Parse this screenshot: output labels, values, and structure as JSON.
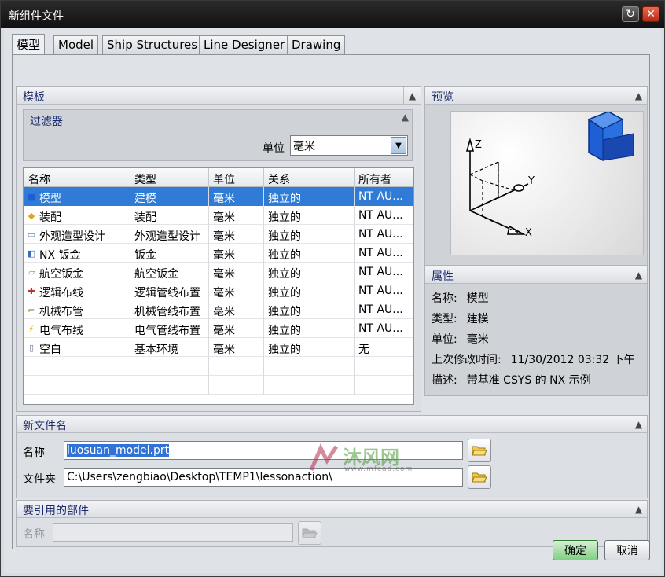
{
  "window": {
    "title": "新组件文件"
  },
  "tabs": [
    {
      "label": "模型",
      "active": true
    },
    {
      "label": "Model"
    },
    {
      "label": "Ship Structures"
    },
    {
      "label": "Line Designer"
    },
    {
      "label": "Drawing"
    }
  ],
  "template": {
    "header": "模板",
    "filter": {
      "title": "过滤器",
      "unit_label": "单位",
      "unit_value": "毫米"
    },
    "columns": [
      "名称",
      "类型",
      "单位",
      "关系",
      "所有者"
    ],
    "rows": [
      {
        "name": "模型",
        "type": "建模",
        "unit": "毫米",
        "relation": "独立的",
        "owner": "NT AU...",
        "icon": "model-icon",
        "selected": true
      },
      {
        "name": "装配",
        "type": "装配",
        "unit": "毫米",
        "relation": "独立的",
        "owner": "NT AU...",
        "icon": "assembly-icon"
      },
      {
        "name": "外观造型设计",
        "type": "外观造型设计",
        "unit": "毫米",
        "relation": "独立的",
        "owner": "NT AU...",
        "icon": "shape-studio-icon"
      },
      {
        "name": "NX 钣金",
        "type": "钣金",
        "unit": "毫米",
        "relation": "独立的",
        "owner": "NT AU...",
        "icon": "sheet-metal-icon"
      },
      {
        "name": "航空钣金",
        "type": "航空钣金",
        "unit": "毫米",
        "relation": "独立的",
        "owner": "NT AU...",
        "icon": "aero-sheet-metal-icon"
      },
      {
        "name": "逻辑布线",
        "type": "逻辑管线布置",
        "unit": "毫米",
        "relation": "独立的",
        "owner": "NT AU...",
        "icon": "logical-routing-icon"
      },
      {
        "name": "机械布管",
        "type": "机械管线布置",
        "unit": "毫米",
        "relation": "独立的",
        "owner": "NT AU...",
        "icon": "mechanical-routing-icon"
      },
      {
        "name": "电气布线",
        "type": "电气管线布置",
        "unit": "毫米",
        "relation": "独立的",
        "owner": "NT AU...",
        "icon": "electrical-routing-icon"
      },
      {
        "name": "空白",
        "type": "基本环境",
        "unit": "毫米",
        "relation": "独立的",
        "owner": "无",
        "icon": "blank-file-icon"
      }
    ]
  },
  "preview": {
    "header": "预览",
    "axis_z": "Z",
    "axis_y": "Y",
    "axis_x": "X"
  },
  "properties": {
    "header": "属性",
    "items": [
      {
        "key": "名称:",
        "value": "模型"
      },
      {
        "key": "类型:",
        "value": "建模"
      },
      {
        "key": "单位:",
        "value": "毫米"
      },
      {
        "key": "上次修改时间:",
        "value": "11/30/2012 03:32 下午"
      },
      {
        "key": "描述:",
        "value": "带基准 CSYS 的 NX 示例"
      }
    ]
  },
  "new_file": {
    "header": "新文件名",
    "name_label": "名称",
    "name_value": "luosuan_model.prt",
    "folder_label": "文件夹",
    "folder_value": "C:\\Users\\zengbiao\\Desktop\\TEMP1\\lessonaction\\"
  },
  "ref_part": {
    "header": "要引用的部件",
    "name_label": "名称",
    "name_value": ""
  },
  "buttons": {
    "ok": "确定",
    "cancel": "取消"
  },
  "watermark": {
    "title": "沐风网",
    "sub": "www.mfcad.com"
  },
  "colors": {
    "selection": "#2f7bd6",
    "ok_button": "#7fcf82",
    "header_text": "#1a2a6c"
  }
}
